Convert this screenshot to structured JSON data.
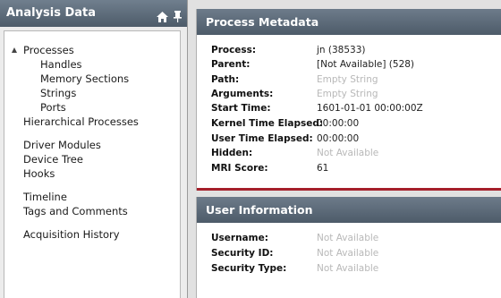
{
  "left_panel": {
    "title": "Analysis Data",
    "icons": [
      "home-icon",
      "pin-icon"
    ],
    "tree": {
      "processes": "Processes",
      "children": [
        "Handles",
        "Memory Sections",
        "Strings",
        "Ports"
      ],
      "hierarchical_processes": "Hierarchical Processes",
      "driver_modules": "Driver Modules",
      "device_tree": "Device Tree",
      "hooks": "Hooks",
      "timeline": "Timeline",
      "tags_and_comments": "Tags and Comments",
      "acquisition_history": "Acquisition History"
    }
  },
  "metadata": {
    "title": "Process Metadata",
    "rows": [
      {
        "label": "Process:",
        "value": " jn (38533)",
        "muted": false
      },
      {
        "label": "Parent:",
        "value": "[Not Available] (528)",
        "muted": false
      },
      {
        "label": "Path:",
        "value": "Empty String",
        "muted": true
      },
      {
        "label": "Arguments:",
        "value": "Empty String",
        "muted": true
      },
      {
        "label": "Start Time:",
        "value": "1601-01-01 00:00:00Z",
        "muted": false
      },
      {
        "label": "Kernel Time Elapsed:",
        "value": "00:00:00",
        "muted": false
      },
      {
        "label": "User Time Elapsed:",
        "value": "00:00:00",
        "muted": false
      },
      {
        "label": "Hidden:",
        "value": "Not Available",
        "muted": true
      },
      {
        "label": "MRI Score:",
        "value": "61",
        "muted": false
      }
    ]
  },
  "user_info": {
    "title": "User Information",
    "rows": [
      {
        "label": "Username:",
        "value": "Not Available",
        "muted": true
      },
      {
        "label": "Security ID:",
        "value": "Not Available",
        "muted": true
      },
      {
        "label": "Security Type:",
        "value": "Not Available",
        "muted": true
      }
    ]
  },
  "colors": {
    "header_gradient_top": "#707f8e",
    "header_gradient_bottom": "#4d5b69",
    "accent_red": "#a51f2a",
    "muted_text": "#b8b8b8"
  }
}
